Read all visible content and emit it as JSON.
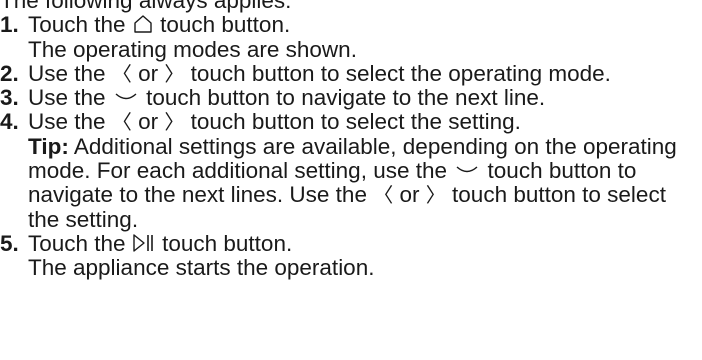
{
  "intro": "The following always applies:",
  "icons": {
    "left": "〈",
    "right": "〉"
  },
  "steps": [
    {
      "number": "1.",
      "before": "Touch the",
      "after": "touch button.",
      "result": "The operating modes are shown."
    },
    {
      "number": "2.",
      "before": "Use the",
      "or": "or",
      "after": "touch button to select the operating mode."
    },
    {
      "number": "3.",
      "before": "Use the",
      "after": "touch button to navigate to the next line."
    },
    {
      "number": "4.",
      "before": "Use the",
      "or": "or",
      "after": "touch button to select the setting.",
      "tip_label": "Tip:",
      "tip_text": "Additional settings are available, depending on the operating mode. For each additional setting, use the",
      "tip_mid": "touch button to navigate to the next lines. Use the",
      "tip_or": "or",
      "tip_end": "touch button to select the setting."
    },
    {
      "number": "5.",
      "before": "Touch the",
      "after": "touch button.",
      "result": "The appliance starts the operation."
    }
  ]
}
